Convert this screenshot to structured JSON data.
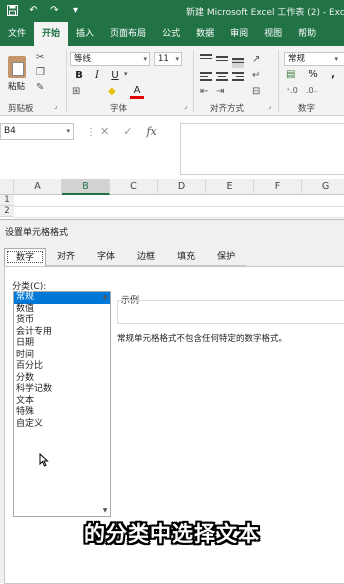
{
  "titlebar": {
    "title": "新建 Microsoft Excel 工作表 (2) - Exc",
    "qat_icons": [
      "save-icon",
      "undo-icon",
      "redo-icon",
      "customize-icon"
    ]
  },
  "ribbon_tabs": [
    "文件",
    "开始",
    "插入",
    "页面布局",
    "公式",
    "数据",
    "审阅",
    "视图",
    "帮助"
  ],
  "active_tab": "开始",
  "ribbon": {
    "paste_label": "粘贴",
    "clipboard_label": "剪贴板",
    "font_name": "等线",
    "font_size": "11",
    "font_group_label": "字体",
    "bold": "B",
    "italic": "I",
    "underline": "U",
    "font_color_glyph": "A",
    "align_group_label": "对齐方式",
    "number_format": "常规",
    "number_group_label": "数字",
    "percent": "%",
    "comma": ","
  },
  "formula_bar": {
    "name_box": "B4",
    "cancel_glyph": "✕",
    "enter_glyph": "✓",
    "fx_glyph": "fx",
    "value": ""
  },
  "grid": {
    "columns": [
      "A",
      "B",
      "C",
      "D",
      "E",
      "F",
      "G"
    ],
    "selected_column": "B",
    "rows": [
      "1",
      "2"
    ]
  },
  "dialog": {
    "title": "设置单元格格式",
    "tabs": [
      "数字",
      "对齐",
      "字体",
      "边框",
      "填充",
      "保护"
    ],
    "active_tab": "数字",
    "category_label": "分类(C):",
    "categories": [
      "常规",
      "数值",
      "货币",
      "会计专用",
      "日期",
      "时间",
      "百分比",
      "分数",
      "科学记数",
      "文本",
      "特殊",
      "自定义"
    ],
    "selected_category": "常规",
    "sample_label": "示例",
    "description": "常规单元格格式不包含任何特定的数字格式。"
  },
  "caption": "的分类中选择文本",
  "colors": {
    "excel_green": "#217346",
    "selection_blue": "#0078d7"
  }
}
